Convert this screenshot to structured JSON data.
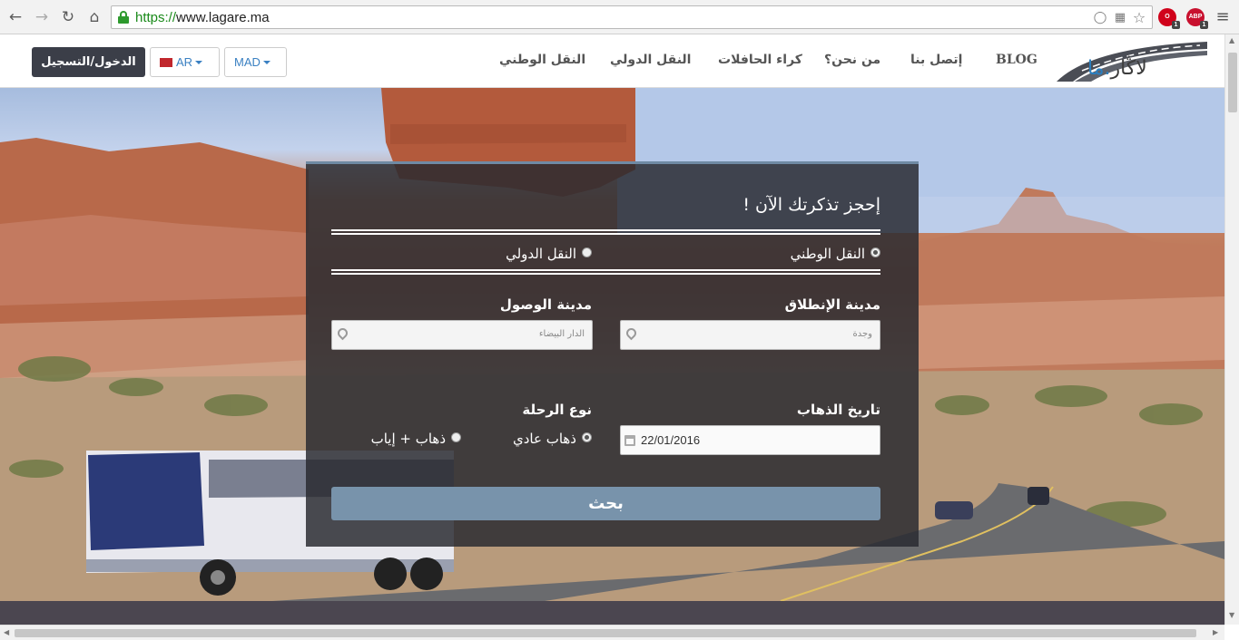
{
  "browser": {
    "url_scheme": "https://",
    "url_host": "www.lagare.ma",
    "back_icon": "arrow-left-icon",
    "forward_icon": "arrow-right-icon",
    "reload_icon": "reload-icon",
    "home_icon": "home-icon",
    "extensions": [
      {
        "name": "opera-icon",
        "badge": "1",
        "color": "#d0021b"
      },
      {
        "name": "adblock-icon",
        "label": "ABP",
        "badge": "1",
        "color": "#c8102e"
      }
    ]
  },
  "header": {
    "logo_text_main": "لاڭار",
    "logo_text_accent": ".ما",
    "nav": {
      "blog": "BLOG",
      "contact": "إتصل بنا",
      "about": "من نحن؟",
      "bus_rental": "كراء الحافلات",
      "international": "النقل الدولي",
      "national": "النقل الوطني"
    },
    "login_button": "الدخول/التسجيل",
    "language": "AR",
    "currency": "MAD"
  },
  "booking": {
    "title": "إحجز تذكرتك الآن !",
    "transport_types": [
      {
        "label": "النقل الوطني",
        "selected": true
      },
      {
        "label": "النقل الدولي",
        "selected": false
      }
    ],
    "departure_label": "مدينة الإنطلاق",
    "departure_value": "وجدة",
    "arrival_label": "مدينة الوصول",
    "arrival_value": "الدار البيضاء",
    "date_label": "تاريخ الذهاب",
    "date_value": "22/01/2016",
    "trip_type_label": "نوع الرحلة",
    "trip_types": [
      {
        "label": "ذهاب عادي",
        "selected": true
      },
      {
        "label": "ذهاب + إياب",
        "selected": false
      }
    ],
    "search_button": "بحث"
  },
  "colors": {
    "accent": "#7893ab",
    "panel_top_border": "#6f8aa4",
    "login_bg": "#3b3e48",
    "link_blue": "#3a80c2"
  }
}
